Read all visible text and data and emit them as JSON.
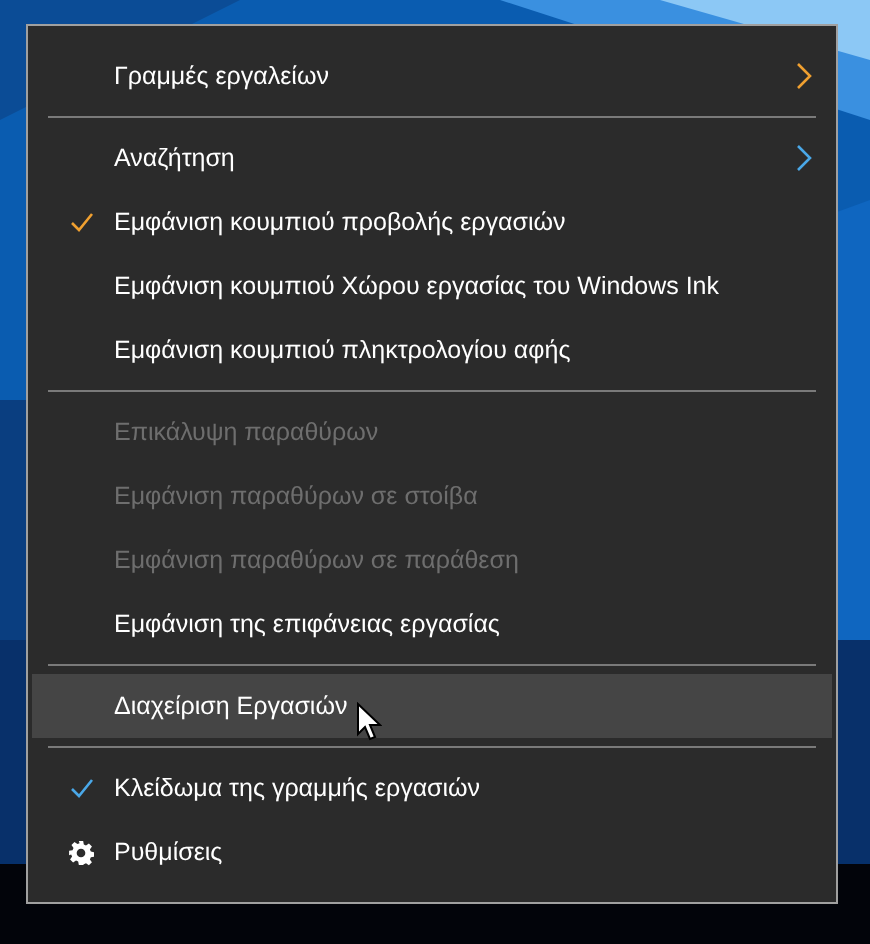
{
  "menu": {
    "items": [
      {
        "kind": "submenu",
        "label": "Γραμμές εργαλείων",
        "color": "#f0a030",
        "highlighted": false
      },
      {
        "kind": "separator"
      },
      {
        "kind": "submenu",
        "label": "Αναζήτηση",
        "color": "#4aa8e8",
        "highlighted": false
      },
      {
        "kind": "item",
        "label": "Εμφάνιση κουμπιού προβολής εργασιών",
        "checked": true,
        "color": "#f0a030",
        "disabled": false,
        "highlighted": false
      },
      {
        "kind": "item",
        "label": "Εμφάνιση κουμπιού Χώρου εργασίας του Windows Ink",
        "checked": false,
        "disabled": false,
        "highlighted": false
      },
      {
        "kind": "item",
        "label": "Εμφάνιση κουμπιού πληκτρολογίου αφής",
        "checked": false,
        "disabled": false,
        "highlighted": false
      },
      {
        "kind": "separator"
      },
      {
        "kind": "item",
        "label": "Επικάλυψη παραθύρων",
        "checked": false,
        "disabled": true,
        "highlighted": false
      },
      {
        "kind": "item",
        "label": "Εμφάνιση παραθύρων σε στοίβα",
        "checked": false,
        "disabled": true,
        "highlighted": false
      },
      {
        "kind": "item",
        "label": "Εμφάνιση παραθύρων σε παράθεση",
        "checked": false,
        "disabled": true,
        "highlighted": false
      },
      {
        "kind": "item",
        "label": "Εμφάνιση της επιφάνειας εργασίας",
        "checked": false,
        "disabled": false,
        "highlighted": false
      },
      {
        "kind": "separator"
      },
      {
        "kind": "item",
        "label": "Διαχείριση Εργασιών",
        "checked": false,
        "disabled": false,
        "highlighted": true
      },
      {
        "kind": "separator"
      },
      {
        "kind": "item",
        "label": "Κλείδωμα της γραμμής εργασιών",
        "checked": true,
        "color": "#4aa8e8",
        "disabled": false,
        "highlighted": false
      },
      {
        "kind": "settings",
        "label": "Ρυθμίσεις",
        "highlighted": false
      }
    ]
  }
}
